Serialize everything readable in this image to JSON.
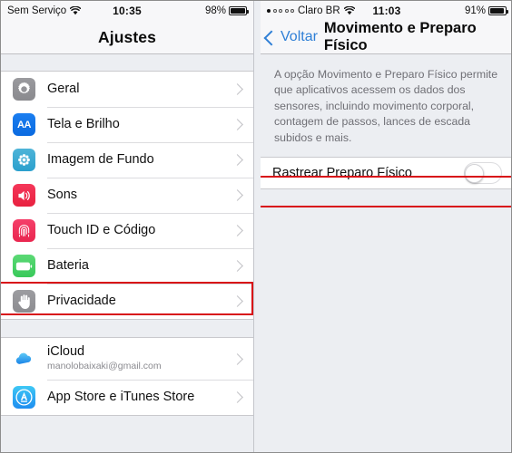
{
  "left": {
    "status": {
      "carrier": "Sem Serviço",
      "wifi_icon": "wifi-icon",
      "time": "10:35",
      "battery_percent": "98%",
      "battery_level": 98
    },
    "nav": {
      "title": "Ajustes"
    },
    "groups": [
      {
        "rows": [
          {
            "label": "Geral",
            "icon": "gear-icon",
            "icon_class": "ic-gear",
            "name": "geral"
          },
          {
            "label": "Tela e Brilho",
            "icon": "display-text-size-icon",
            "icon_class": "ic-display",
            "name": "tela-e-brilho"
          },
          {
            "label": "Imagem de Fundo",
            "icon": "wallpaper-flower-icon",
            "icon_class": "ic-wallpaper",
            "name": "imagem-de-fundo"
          },
          {
            "label": "Sons",
            "icon": "speaker-icon",
            "icon_class": "ic-sounds",
            "name": "sons"
          },
          {
            "label": "Touch ID e Código",
            "icon": "fingerprint-icon",
            "icon_class": "ic-touchid",
            "name": "touch-id-e-codigo"
          },
          {
            "label": "Bateria",
            "icon": "battery-icon",
            "icon_class": "ic-battery",
            "name": "bateria"
          },
          {
            "label": "Privacidade",
            "icon": "hand-privacy-icon",
            "icon_class": "ic-privacy",
            "name": "privacidade",
            "highlighted": true
          }
        ]
      },
      {
        "rows": [
          {
            "label": "iCloud",
            "sublabel": "manolobaixaki@gmail.com",
            "icon": "icloud-cloud-icon",
            "icon_class": "ic-icloud",
            "name": "icloud"
          },
          {
            "label": "App Store e iTunes Store",
            "icon": "app-store-icon",
            "icon_class": "ic-appstore",
            "name": "app-store-e-itunes-store"
          }
        ]
      }
    ]
  },
  "right": {
    "status": {
      "carrier": "Claro BR",
      "signal_filled": 1,
      "signal_total": 5,
      "wifi_icon": "wifi-icon",
      "time": "11:03",
      "battery_percent": "91%",
      "battery_level": 91
    },
    "nav": {
      "back_label": "Voltar",
      "back_icon": "chevron-left-icon",
      "title": "Movimento e Preparo Físico"
    },
    "description": "A opção Movimento e Preparo Físico permite que aplicativos acessem os dados dos sensores, incluindo movimento corporal, contagem de passos, lances de escada subidos e mais.",
    "toggle": {
      "label": "Rastrear Preparo Físico",
      "state": "off"
    }
  },
  "colors": {
    "highlight": "#d80d16",
    "accent_blue": "#2f7fd6",
    "panel_bg": "#eceef2",
    "row_bg": "#ffffff"
  }
}
